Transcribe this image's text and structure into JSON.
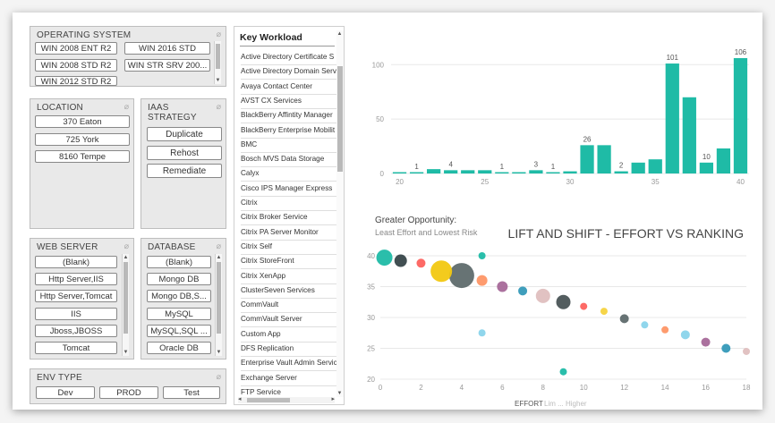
{
  "os_slicer": {
    "title": "OPERATING SYSTEM",
    "items": [
      "WIN 2008 ENT R2",
      "WIN 2016 STD",
      "WIN 2008 STD R2",
      "WIN STR SRV 200...",
      "WIN 2012 STD R2"
    ]
  },
  "location_slicer": {
    "title": "LOCATION",
    "items": [
      "370 Eaton",
      "725 York",
      "8160 Tempe"
    ]
  },
  "iaas_slicer": {
    "title_line1": "IAAS",
    "title_line2": "STRATEGY",
    "items": [
      "Duplicate",
      "Rehost",
      "Remediate"
    ]
  },
  "web_server_slicer": {
    "title": "WEB SERVER",
    "items": [
      "(Blank)",
      "Http Server,IIS",
      "Http Server,Tomcat",
      "IIS",
      "Jboss,JBOSS",
      "Tomcat"
    ]
  },
  "database_slicer": {
    "title": "DATABASE",
    "items": [
      "(Blank)",
      "Mongo DB",
      "Mongo DB,S...",
      "MySQL",
      "MySQL,SQL ...",
      "Oracle DB"
    ]
  },
  "env_type_slicer": {
    "title": "ENV TYPE",
    "items": [
      "Dev",
      "PROD",
      "Test"
    ]
  },
  "key_workload": {
    "title": "Key Workload",
    "items": [
      "Active Directory Certificate S",
      "Active Directory Domain Serv",
      "Avaya Contact Center",
      "AVST CX Services",
      "BlackBerry Affintity Manager",
      "BlackBerry Enterprise Mobilit",
      "BMC",
      "Bosch MVS Data Storage",
      "Calyx",
      "Cisco IPS Manager Express",
      "Citrix",
      "Citrix Broker Service",
      "Citrix PA Server Monitor",
      "Citrix Self",
      "Citrix StoreFront",
      "Citrix XenApp",
      "ClusterSeven Services",
      "CommVault",
      "CommVault Server",
      "Custom App",
      "DFS Replication",
      "Enterprise Vault Admin Servic",
      "Exchange Server",
      "FTP Service"
    ]
  },
  "colors": {
    "bar": "#1fbba6",
    "axis_text": "#999999",
    "grid": "#e8e8e8"
  },
  "chart_data": [
    {
      "type": "bar",
      "title": "",
      "x": [
        20,
        21,
        22,
        23,
        24,
        25,
        26,
        27,
        28,
        29,
        30,
        31,
        32,
        33,
        34,
        35,
        36,
        37,
        38,
        39,
        40
      ],
      "values": [
        1,
        1,
        4,
        3,
        3,
        3,
        1,
        1,
        3,
        1,
        2,
        26,
        26,
        2,
        10,
        13,
        101,
        70,
        10,
        23,
        106
      ],
      "data_labels": [
        {
          "x": 21,
          "text": "1"
        },
        {
          "x": 23,
          "text": "4"
        },
        {
          "x": 26,
          "text": "1"
        },
        {
          "x": 28,
          "text": "3"
        },
        {
          "x": 29,
          "text": "1"
        },
        {
          "x": 31,
          "text": "26"
        },
        {
          "x": 33,
          "text": "2"
        },
        {
          "x": 36,
          "text": "101"
        },
        {
          "x": 38,
          "text": "10"
        },
        {
          "x": 40,
          "text": "106"
        }
      ],
      "x_ticks": [
        20,
        25,
        30,
        35,
        40
      ],
      "y_ticks": [
        0,
        50,
        100
      ],
      "ylim": [
        0,
        115
      ]
    },
    {
      "type": "scatter",
      "title": "LIFT AND SHIFT - EFFORT VS RANKING",
      "subtitle_line1": "Greater Opportunity:",
      "subtitle_line2": "Least Effort and Lowest Risk",
      "xlabel": "EFFORT",
      "xlabel_suffix": "Lim ... Higher",
      "x_ticks": [
        0,
        2,
        4,
        6,
        8,
        10,
        12,
        14,
        16,
        18
      ],
      "y_ticks": [
        20,
        25,
        30,
        35,
        40
      ],
      "xlim": [
        0,
        18
      ],
      "ylim": [
        20,
        40
      ],
      "points": [
        {
          "x": 0.2,
          "y": 39.7,
          "r": 9,
          "color": "#1fbba6"
        },
        {
          "x": 1,
          "y": 39.2,
          "r": 7,
          "color": "#374649"
        },
        {
          "x": 2,
          "y": 38.8,
          "r": 5,
          "color": "#fd625e"
        },
        {
          "x": 3,
          "y": 37.5,
          "r": 12,
          "color": "#f2c811"
        },
        {
          "x": 4,
          "y": 36.8,
          "r": 14,
          "color": "#5f6b6d"
        },
        {
          "x": 5,
          "y": 36.0,
          "r": 6,
          "color": "#fe9666"
        },
        {
          "x": 5,
          "y": 40.0,
          "r": 4,
          "color": "#1fbba6"
        },
        {
          "x": 6,
          "y": 35.0,
          "r": 6,
          "color": "#a66999"
        },
        {
          "x": 7,
          "y": 34.3,
          "r": 5,
          "color": "#3599b8"
        },
        {
          "x": 8,
          "y": 33.5,
          "r": 8,
          "color": "#dfbfbf"
        },
        {
          "x": 9,
          "y": 32.5,
          "r": 8,
          "color": "#4a5456"
        },
        {
          "x": 10,
          "y": 31.8,
          "r": 4,
          "color": "#fd625e"
        },
        {
          "x": 11,
          "y": 31.0,
          "r": 4,
          "color": "#f5d33f"
        },
        {
          "x": 12,
          "y": 29.8,
          "r": 5,
          "color": "#5f6b6d"
        },
        {
          "x": 13,
          "y": 28.8,
          "r": 4,
          "color": "#8ad4eb"
        },
        {
          "x": 14,
          "y": 28.0,
          "r": 4,
          "color": "#fe9666"
        },
        {
          "x": 15,
          "y": 27.2,
          "r": 5,
          "color": "#8ad4eb"
        },
        {
          "x": 16,
          "y": 26.0,
          "r": 5,
          "color": "#a66999"
        },
        {
          "x": 17,
          "y": 25.0,
          "r": 5,
          "color": "#3599b8"
        },
        {
          "x": 18,
          "y": 24.5,
          "r": 4,
          "color": "#dfbfbf"
        },
        {
          "x": 5,
          "y": 27.5,
          "r": 4,
          "color": "#8ad4eb"
        },
        {
          "x": 9,
          "y": 21.2,
          "r": 4,
          "color": "#1fbba6"
        }
      ]
    }
  ]
}
